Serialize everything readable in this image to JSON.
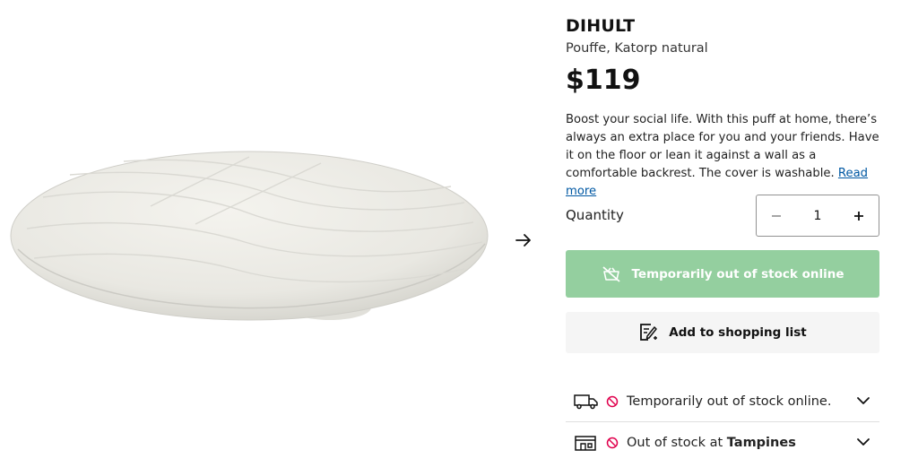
{
  "product": {
    "name": "DIHULT",
    "subtitle": "Pouffe, Katorp natural",
    "price": "$119",
    "description": "Boost your social life. With this puff at home, there’s always an extra place for you and your friends. Have it on the floor or lean it against a wall as a comfortable backrest. The cover is washable.",
    "read_more": "Read more"
  },
  "gallery": {
    "next_icon": "arrow-right-icon"
  },
  "quantity": {
    "label": "Quantity",
    "value": "1",
    "decrease_icon": "minus-icon",
    "increase_icon": "plus-icon"
  },
  "buttons": {
    "out_of_stock_label": "Temporarily out of stock online",
    "out_of_stock_icon": "cart-unavailable-icon",
    "shopping_list_label": "Add to shopping list",
    "shopping_list_icon": "list-add-icon"
  },
  "availability": {
    "delivery": {
      "text": "Temporarily out of stock online.",
      "icon": "truck-icon",
      "status_icon": "unavailable-icon"
    },
    "store": {
      "prefix": "Out of stock at ",
      "store_name": "Tampines",
      "icon": "store-icon",
      "status_icon": "unavailable-icon"
    }
  },
  "colors": {
    "oos_button": "#94cf9f",
    "list_button": "#f5f5f5",
    "link": "#0058a3",
    "unavailable": "#e0004d"
  }
}
